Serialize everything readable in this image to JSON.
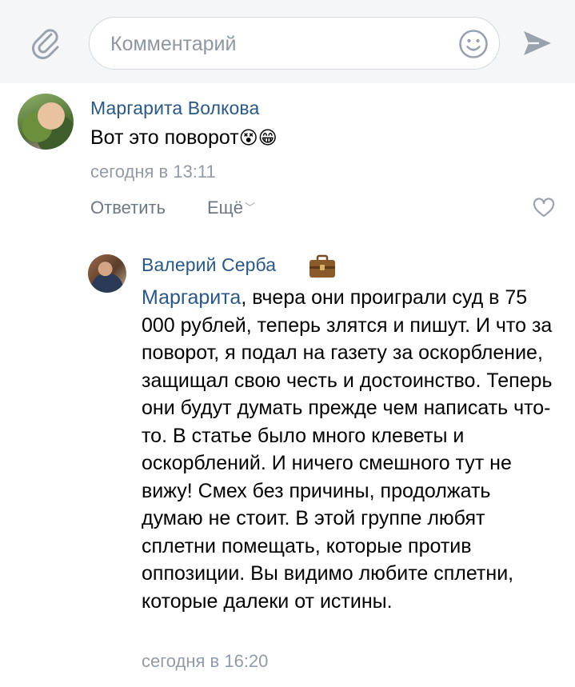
{
  "composer": {
    "placeholder": "Комментарий",
    "value": ""
  },
  "icons": {
    "attach": "paperclip-icon",
    "emoji": "smile-icon",
    "send": "send-icon",
    "like": "heart-icon",
    "badge": "briefcase-icon"
  },
  "colors": {
    "link_blue": "#2a5885",
    "muted": "#939ba5",
    "composer_bg": "#f5f6f8"
  },
  "comments": [
    {
      "author": "Маргарита Волкова",
      "text": "Вот это поворот",
      "emoji": "😵😁",
      "date": "сегодня в 13:11",
      "actions": {
        "reply": "Ответить",
        "more": "Ещё"
      }
    },
    {
      "author": "Валерий Серба",
      "mention": "Маргарита",
      "text": ", вчера они проиграли суд в 75 000 рублей, теперь злятся и пишут. И что за поворот, я подал на газету за оскорбление, защищал свою честь и достоинство. Теперь они будут думать прежде чем написать что-то. В статье было много клеветы и оскорблений. И ничего смешного тут не вижу! Смех без причины, продолжать думаю не стоит. В этой группе любят сплетни помещать, которые против оппозиции. Вы видимо любите сплетни, которые далеки от истины.",
      "date": "сегодня в 16:20"
    }
  ]
}
